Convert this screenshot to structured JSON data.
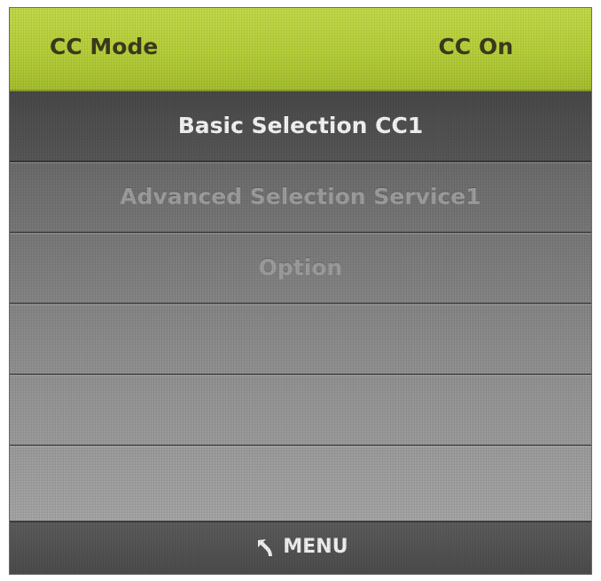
{
  "header": {
    "mode_label": "CC Mode",
    "status_label": "CC On"
  },
  "menu": {
    "items": [
      {
        "label": "Basic Selection CC1",
        "state": "selected"
      },
      {
        "label": "Advanced Selection Service1",
        "state": "disabled"
      },
      {
        "label": "Option",
        "state": "disabled"
      },
      {
        "label": "",
        "state": "empty"
      },
      {
        "label": "",
        "state": "empty"
      },
      {
        "label": "",
        "state": "empty"
      }
    ]
  },
  "footer": {
    "back_icon": "back-arrow-icon",
    "menu_label": "MENU"
  },
  "colors": {
    "header_accent": "#b6cf3a",
    "selected_text": "#f4f4f4",
    "disabled_text": "#9d9d9d"
  }
}
